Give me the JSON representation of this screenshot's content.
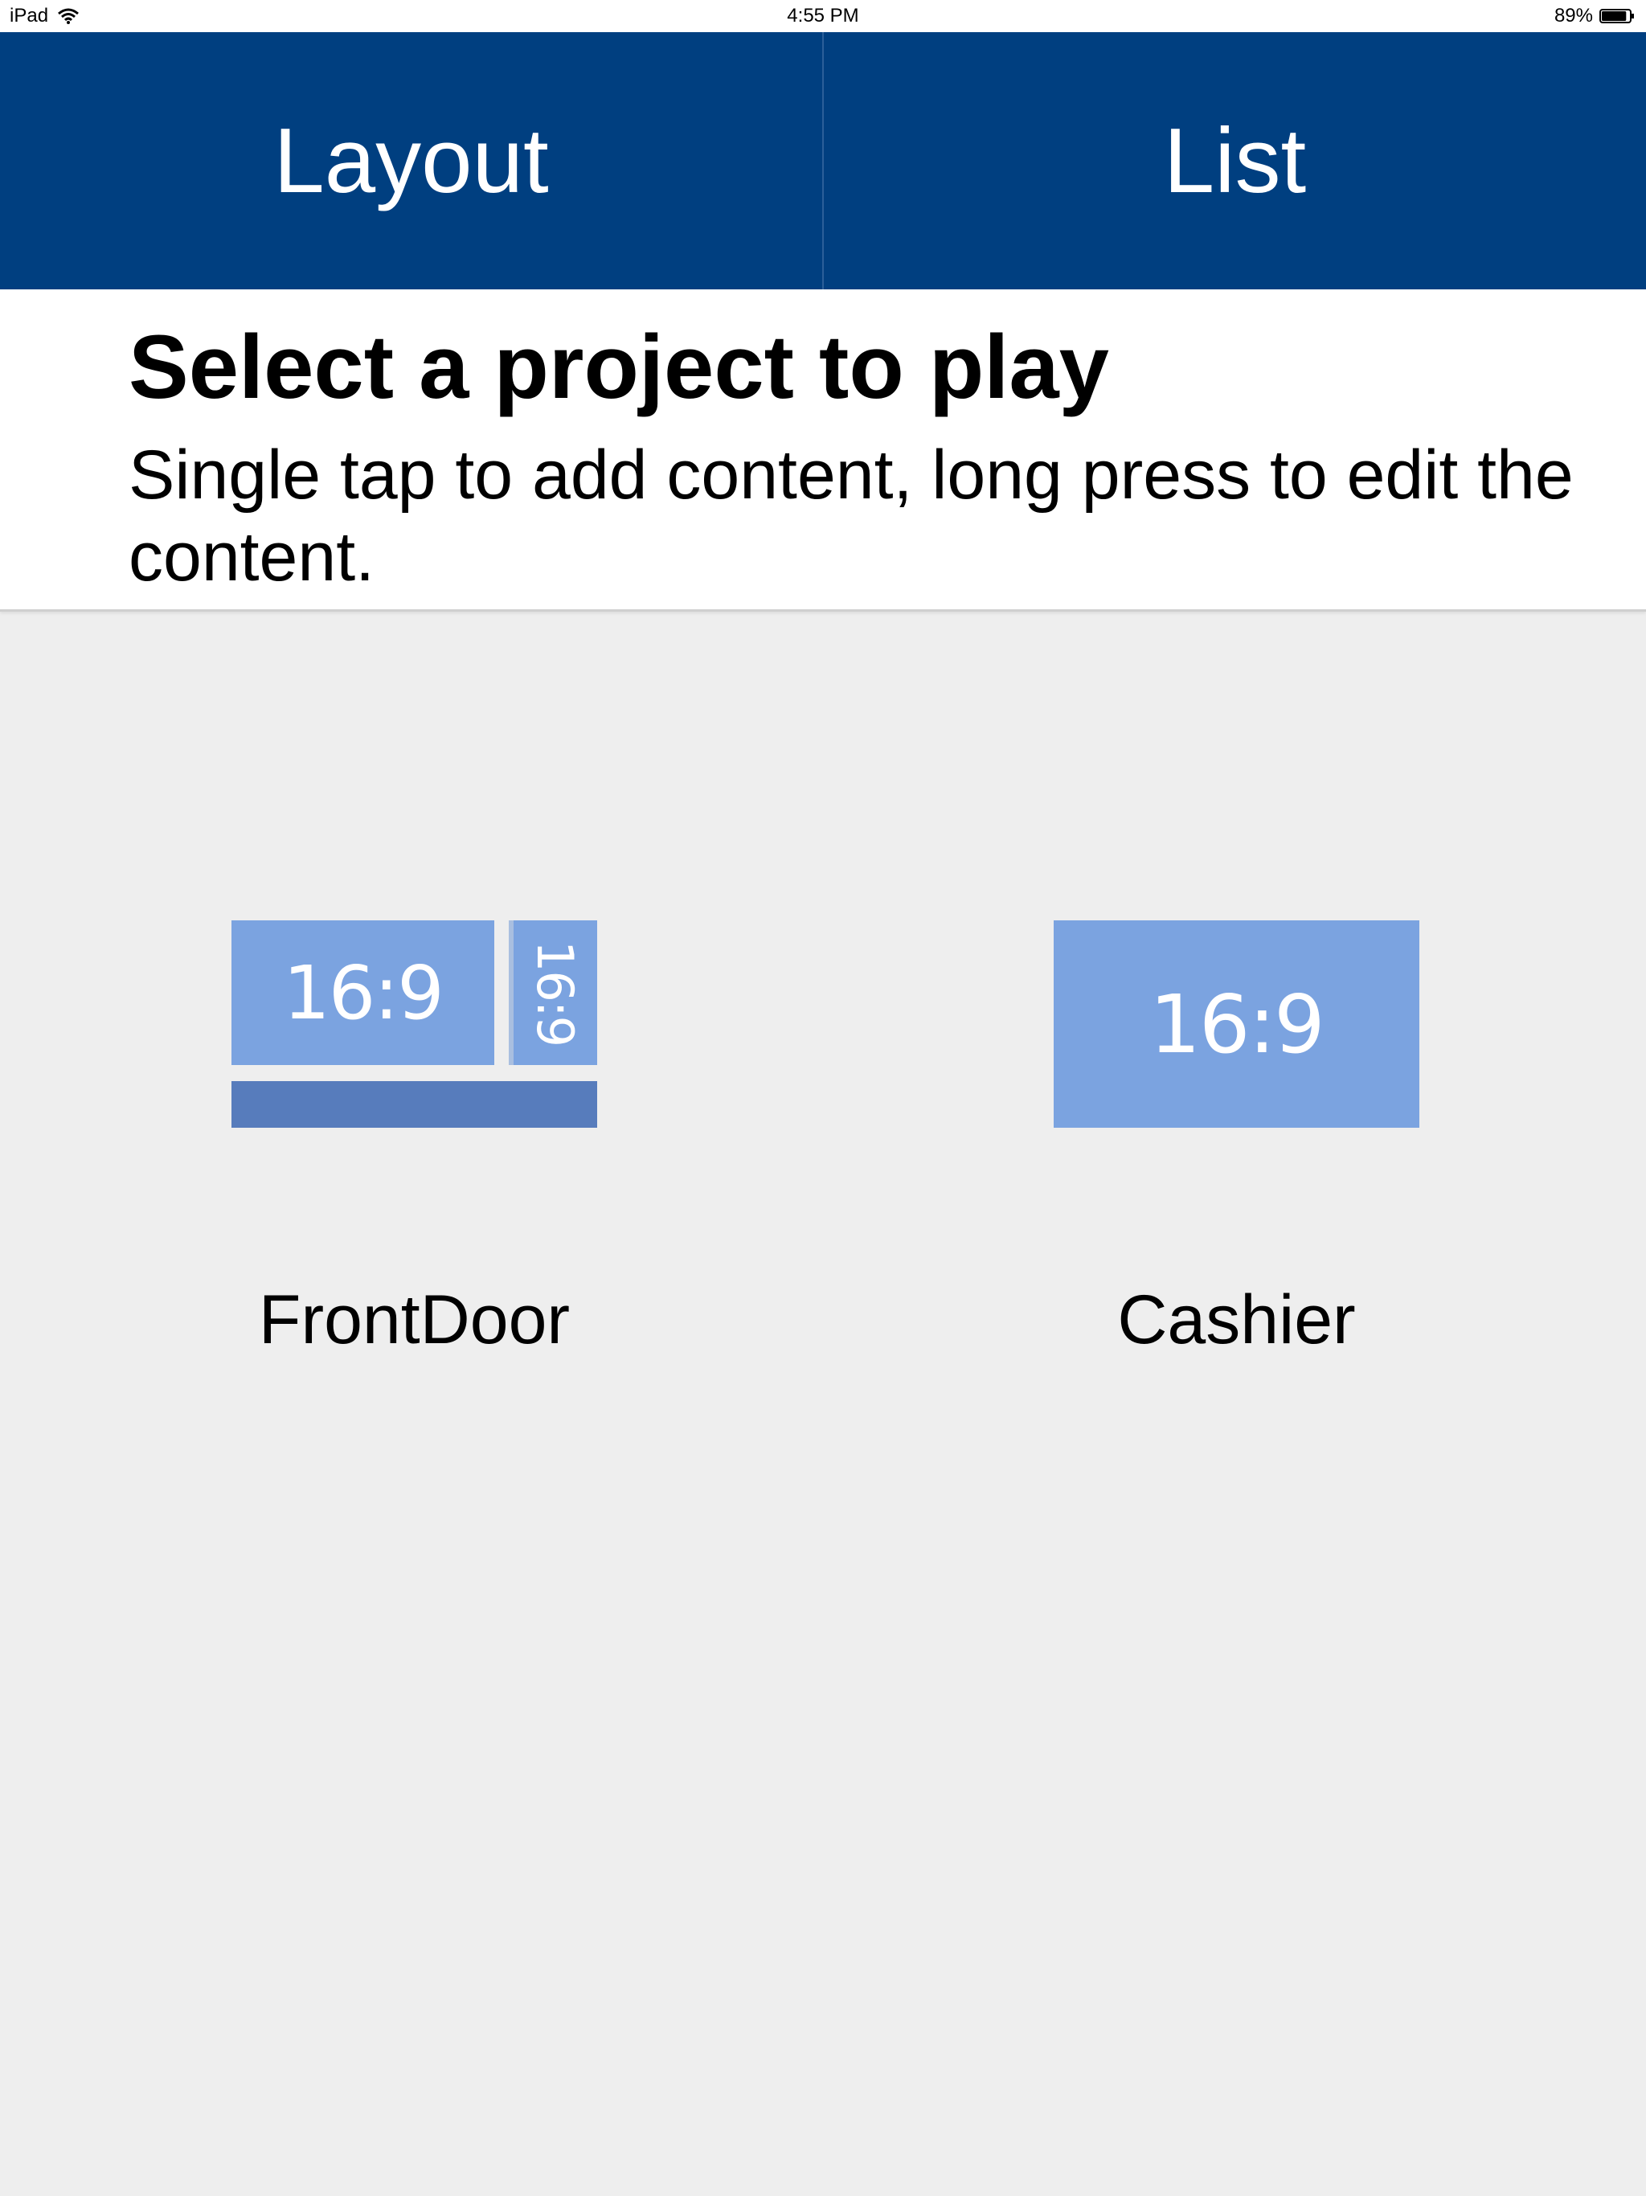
{
  "status_bar": {
    "device": "iPad",
    "time": "4:55 PM",
    "battery": "89%",
    "battery_level": 0.89
  },
  "tabs": [
    {
      "label": "Layout"
    },
    {
      "label": "List"
    }
  ],
  "header": {
    "title": "Select a project to play",
    "subtitle": "Single tap to add content, long press to edit the content."
  },
  "projects": [
    {
      "name": "FrontDoor",
      "zones": {
        "main": "16:9",
        "side": "16:9"
      }
    },
    {
      "name": "Cashier",
      "zones": {
        "main": "16:9"
      }
    }
  ],
  "colors": {
    "tab_bar": "#003f80",
    "zone": "#7ba3e0",
    "zone_dark": "#577cbc",
    "background": "#eeeeee"
  },
  "icons": [
    "wifi-icon",
    "battery-icon"
  ]
}
